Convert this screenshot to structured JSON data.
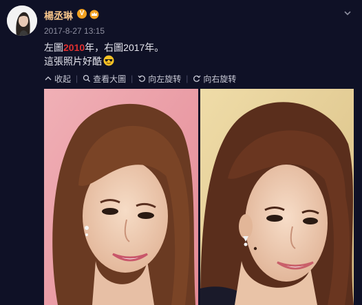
{
  "post": {
    "username": "楊丞琳",
    "verified_badge": "V",
    "timestamp": "2017-8-27 13:15",
    "text_line1_before": "左圖",
    "text_line1_highlight": "2010",
    "text_line1_after": "年，右圖2017年。",
    "text_line2": "這張照片好酷",
    "emoji": "sunglasses-face",
    "colors": {
      "background": "#0f1126",
      "username": "#f5c48a",
      "highlight": "#e03030",
      "muted": "#8e8fa0"
    }
  },
  "toolbar": {
    "collapse_label": "收起",
    "view_large_label": "查看大圖",
    "rotate_left_label": "向左旋转",
    "rotate_right_label": "向右旋转"
  },
  "images": {
    "left_subject": "photo-2010",
    "right_subject": "photo-2017"
  }
}
